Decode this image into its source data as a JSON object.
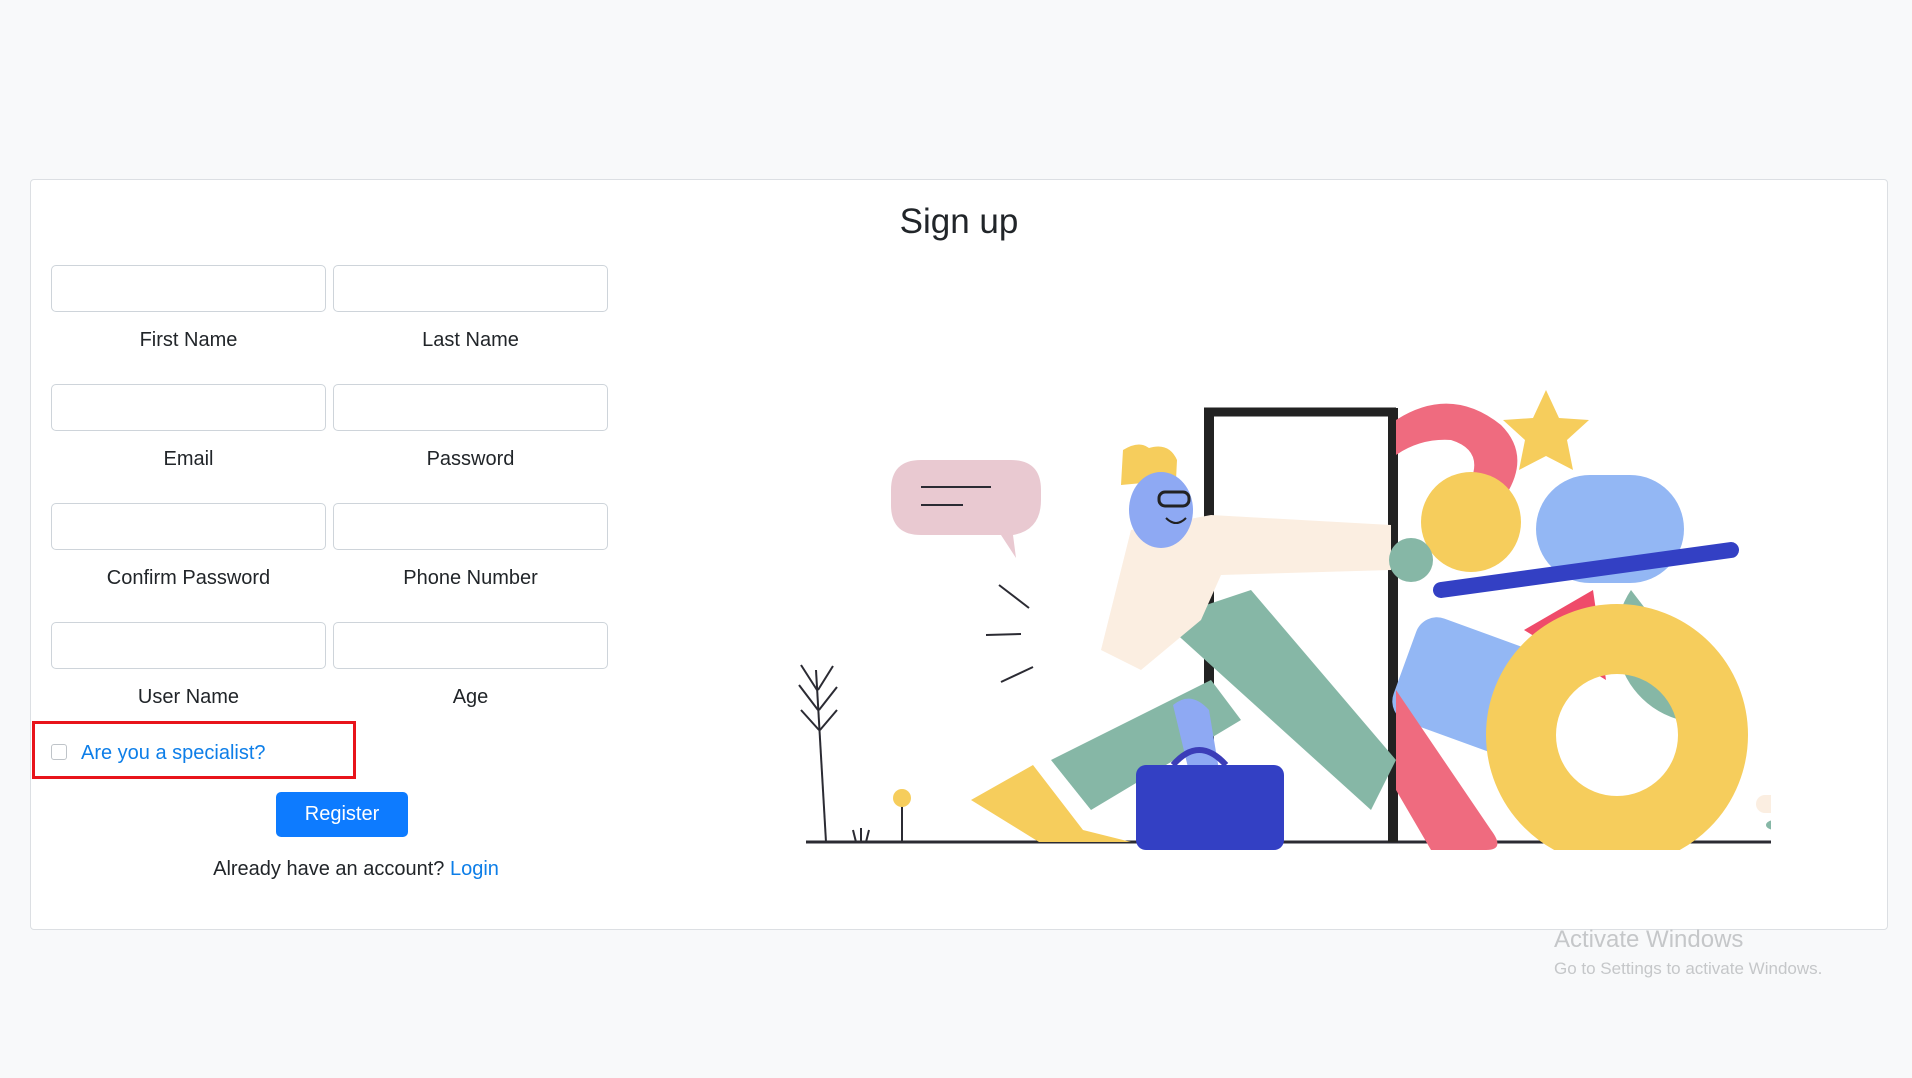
{
  "form": {
    "title": "Sign up",
    "fields": [
      {
        "label": "First Name",
        "value": "",
        "placeholder": ""
      },
      {
        "label": "Last Name",
        "value": "",
        "placeholder": ""
      },
      {
        "label": "Email",
        "value": "",
        "placeholder": ""
      },
      {
        "label": "Password",
        "value": "",
        "placeholder": ""
      },
      {
        "label": "Confirm Password",
        "value": "",
        "placeholder": ""
      },
      {
        "label": "Phone Number",
        "value": "",
        "placeholder": ""
      },
      {
        "label": "User Name",
        "value": "",
        "placeholder": ""
      },
      {
        "label": "Age",
        "value": "",
        "placeholder": ""
      }
    ],
    "specialist_label": "Are you a specialist?",
    "specialist_checked": false,
    "register_label": "Register",
    "login_prompt": "Already have an account?",
    "login_link": "Login"
  },
  "watermark": {
    "title": "Activate Windows",
    "subtitle": "Go to Settings to activate Windows."
  },
  "colors": {
    "primary": "#0d7bff",
    "link": "#0d7ee8",
    "highlight": "#e8141b",
    "background": "#f8f9fa"
  }
}
